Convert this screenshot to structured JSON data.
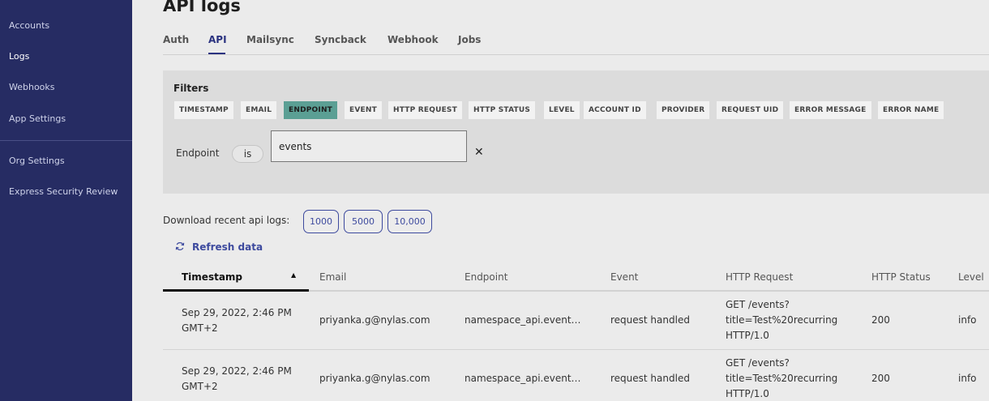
{
  "sidebar": {
    "items": [
      {
        "label": "Accounts"
      },
      {
        "label": "Logs"
      },
      {
        "label": "Webhooks"
      },
      {
        "label": "App Settings"
      },
      {
        "label": "Org Settings"
      },
      {
        "label": "Express Security Review"
      }
    ]
  },
  "page": {
    "title": "API logs"
  },
  "tabs": [
    {
      "label": "Auth"
    },
    {
      "label": "API"
    },
    {
      "label": "Mailsync"
    },
    {
      "label": "Syncback"
    },
    {
      "label": "Webhook"
    },
    {
      "label": "Jobs"
    }
  ],
  "filters": {
    "title": "Filters",
    "chips": [
      {
        "label": "TIMESTAMP"
      },
      {
        "label": "EMAIL"
      },
      {
        "label": "ENDPOINT"
      },
      {
        "label": "EVENT"
      },
      {
        "label": "HTTP REQUEST"
      },
      {
        "label": "HTTP STATUS"
      },
      {
        "label": "LEVEL"
      },
      {
        "label": "ACCOUNT ID"
      },
      {
        "label": "PROVIDER"
      },
      {
        "label": "REQUEST UID"
      },
      {
        "label": "ERROR MESSAGE"
      },
      {
        "label": "ERROR NAME"
      }
    ],
    "active_chip": "ENDPOINT",
    "row": {
      "field": "Endpoint",
      "operator": "is",
      "value": "events",
      "clear_icon": "✕"
    }
  },
  "download": {
    "label": "Download recent api logs:",
    "options": [
      {
        "label": "1000"
      },
      {
        "label": "5000"
      },
      {
        "label": "10,000"
      }
    ]
  },
  "refresh": {
    "label": "Refresh data",
    "icon": "refresh-icon"
  },
  "table": {
    "sorted_column": "Timestamp",
    "sort_icon": "▲",
    "columns": [
      {
        "label": "Timestamp"
      },
      {
        "label": "Email"
      },
      {
        "label": "Endpoint"
      },
      {
        "label": "Event"
      },
      {
        "label": "HTTP Request"
      },
      {
        "label": "HTTP Status"
      },
      {
        "label": "Level"
      }
    ],
    "rows": [
      {
        "timestamp": "Sep 29, 2022, 2:46 PM GMT+2",
        "email": "priyanka.g@nylas.com",
        "endpoint": "namespace_api.event…",
        "event": "request handled",
        "http_request": "GET /events?title=Test%20recurring HTTP/1.0",
        "http_status": "200",
        "level": "info"
      },
      {
        "timestamp": "Sep 29, 2022, 2:46 PM GMT+2",
        "email": "priyanka.g@nylas.com",
        "endpoint": "namespace_api.event…",
        "event": "request handled",
        "http_request": "GET /events?title=Test%20recurring HTTP/1.0",
        "http_status": "200",
        "level": "info"
      }
    ]
  },
  "colors": {
    "sidebar_bg": "#262c63",
    "accent": "#2b3380",
    "chip_active": "#5b9f94",
    "link": "#3d4a9e"
  }
}
